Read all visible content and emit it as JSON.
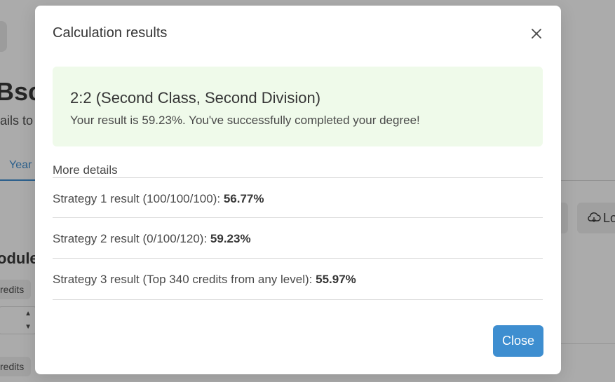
{
  "background": {
    "title": "Bsc",
    "subtitle": "ails to",
    "tab_label": "Year",
    "modules_heading": "odule",
    "chip1": "redits",
    "chip2": "redits",
    "load_button_text": "Lo"
  },
  "modal": {
    "title": "Calculation results",
    "result": {
      "heading": "2:2 (Second Class, Second Division)",
      "text": "Your result is 59.23%. You've successfully completed your degree!"
    },
    "details_label": "More details",
    "strategies": [
      {
        "label": "Strategy 1 result (100/100/100): ",
        "value": "56.77%"
      },
      {
        "label": "Strategy 2 result (0/100/120): ",
        "value": "59.23%"
      },
      {
        "label": "Strategy 3 result (Top 340 credits from any level): ",
        "value": "55.97%"
      }
    ],
    "close_label": "Close"
  },
  "colors": {
    "accent": "#3e8ed0",
    "success_bg": "#effaea",
    "text": "#363636"
  },
  "icons": {
    "close": "close-icon",
    "cloud": "cloud-icon",
    "stepper": "chevron-icon"
  }
}
